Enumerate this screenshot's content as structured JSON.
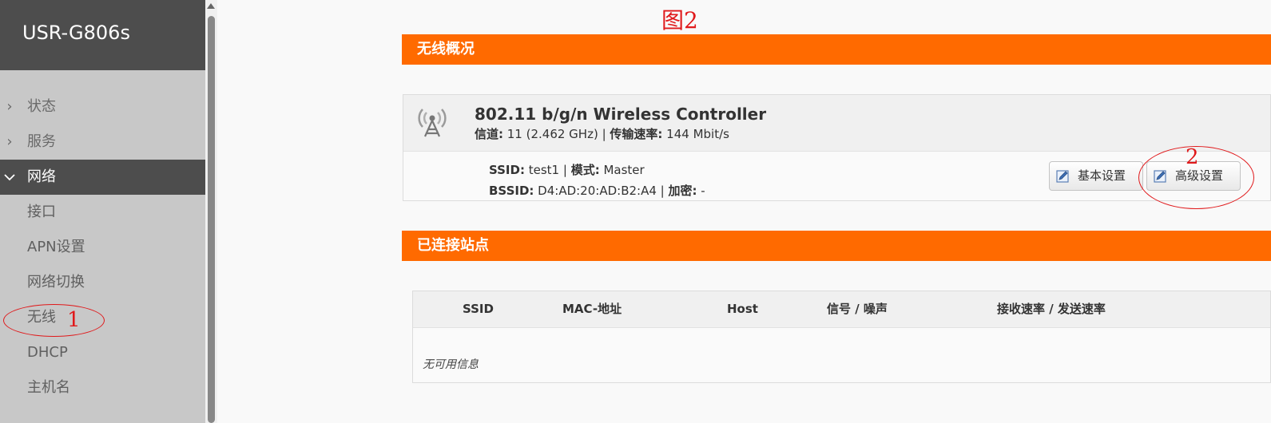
{
  "sidebar": {
    "brand": "USR-G806s",
    "items": [
      {
        "label": "状态",
        "chevron": "›"
      },
      {
        "label": "服务",
        "chevron": "›"
      },
      {
        "label": "网络",
        "chevron": "⌄"
      }
    ],
    "sub_items": [
      "接口",
      "APN设置",
      "网络切换",
      "无线",
      "DHCP",
      "主机名"
    ]
  },
  "annotations": {
    "figure_label": "图2",
    "marker_1": "1",
    "marker_2": "2",
    "color": "#e0191b"
  },
  "wireless_overview": {
    "section_title": "无线概况",
    "controller_title": "802.11 b/g/n Wireless Controller",
    "channel_label": "信道:",
    "channel_value": " 11 (2.462 GHz) | ",
    "rate_label": "传输速率:",
    "rate_value": " 144 Mbit/s",
    "ssid_label": "SSID:",
    "ssid_value": " test1 | ",
    "mode_label": "模式:",
    "mode_value": " Master",
    "bssid_label": "BSSID:",
    "bssid_value": " D4:AD:20:AD:B2:A4 | ",
    "encryption_label": "加密:",
    "encryption_value": " -",
    "basic_button": "基本设置",
    "advanced_button": "高级设置",
    "icon": "antenna-icon"
  },
  "connected_stations": {
    "section_title": "已连接站点",
    "columns": [
      "SSID",
      "MAC-地址",
      "Host",
      "信号 / 噪声",
      "接收速率 / 发送速率"
    ],
    "empty_message": "无可用信息"
  },
  "colors": {
    "accent": "#ff6a00",
    "sidebar_dark": "#4d4d4d",
    "sidebar_bg": "#c8c8c8"
  }
}
